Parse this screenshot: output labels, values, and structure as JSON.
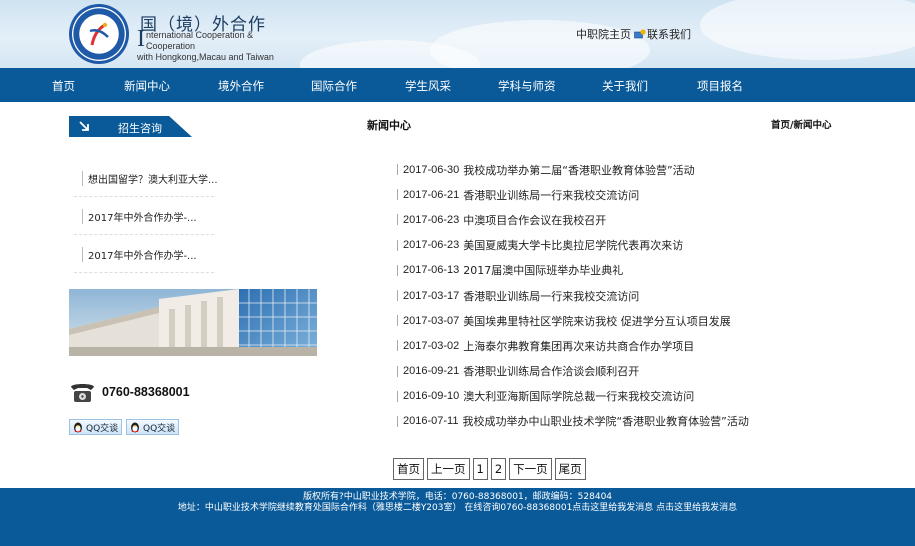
{
  "header": {
    "title": "国（境）外合作",
    "subtitle_line1": "nternational Cooperation & Cooperation",
    "subtitle_line2": "with Hongkong,Macau and Taiwan",
    "subtitle_initial": "I",
    "logo_icon": "school-emblem-icon",
    "home_link": "中职院主页",
    "contact_link": "联系我们"
  },
  "nav": {
    "items": [
      "首页",
      "新闻中心",
      "境外合作",
      "国际合作",
      "学生风采",
      "学科与师资",
      "关于我们",
      "项目报名"
    ]
  },
  "sidebar": {
    "heading": "招生咨询",
    "items": [
      "想出国留学？澳大利亚大学...",
      "2017年中外合作办学-...",
      "2017年中外合作办学-..."
    ],
    "phone": "0760-88368001",
    "qq_buttons": [
      "QQ交谈",
      "QQ交谈"
    ]
  },
  "main": {
    "title": "新闻中心",
    "breadcrumb": "首页/新闻中心",
    "news": [
      {
        "date": "2017-06-30",
        "title": "我校成功举办第二届“香港职业教育体验营”活动"
      },
      {
        "date": "2017-06-21",
        "title": "香港职业训练局一行来我校交流访问"
      },
      {
        "date": "2017-06-23",
        "title": "中澳项目合作会议在我校召开"
      },
      {
        "date": "2017-06-23",
        "title": "美国夏威夷大学卡比奥拉尼学院代表再次来访"
      },
      {
        "date": "2017-06-13",
        "title": "2017届澳中国际班举办毕业典礼"
      },
      {
        "date": "2017-03-17",
        "title": "香港职业训练局一行来我校交流访问"
      },
      {
        "date": "2017-03-07",
        "title": "美国埃弗里特社区学院来访我校 促进学分互认项目发展"
      },
      {
        "date": "2017-03-02",
        "title": "上海泰尔弗教育集团再次来访共商合作办学项目"
      },
      {
        "date": "2016-09-21",
        "title": "香港职业训练局合作洽谈会顺利召开"
      },
      {
        "date": "2016-09-10",
        "title": "澳大利亚海斯国际学院总裁一行来我校交流访问"
      },
      {
        "date": "2016-07-11",
        "title": "我校成功举办中山职业技术学院“香港职业教育体验营”活动"
      }
    ],
    "pager": [
      "首页",
      "上一页",
      "1",
      "2",
      "下一页",
      "尾页"
    ]
  },
  "footer": {
    "line1": "版权所有?中山职业技术学院，电话：0760-88368001，邮政编码：528404",
    "line2": "地址：中山职业技术学院继续教育处国际合作科（雅思楼二楼Y203室） 在线咨询0760-88368001点击这里给我发消息 点击这里给我发消息"
  },
  "colors": {
    "brand_blue": "#0a5a99",
    "header_sky": "#d5e6f3"
  }
}
